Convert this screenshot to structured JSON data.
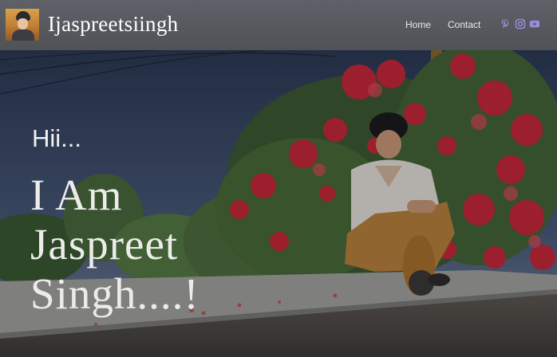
{
  "header": {
    "site_title": "Ijaspreetsiingh",
    "nav": [
      {
        "label": "Home"
      },
      {
        "label": "Contact"
      }
    ],
    "social_icons": [
      "pinterest-icon",
      "instagram-icon",
      "youtube-icon"
    ],
    "social_color": "#9b8bd8"
  },
  "hero": {
    "greeting": "Hii...",
    "headline_lines": [
      "I Am",
      "Jaspreet",
      "Singh....!"
    ]
  },
  "colors": {
    "header_bg": "#56595e",
    "hero_text": "#ecece8"
  }
}
